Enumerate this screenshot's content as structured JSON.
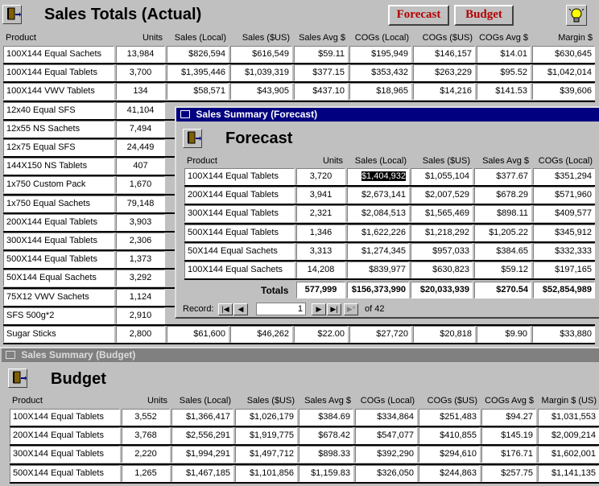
{
  "actual": {
    "title": "Sales Totals (Actual)",
    "buttons": {
      "forecast": "Forecast",
      "budget": "Budget"
    },
    "headers": [
      "Product",
      "Units",
      "Sales (Local)",
      "Sales ($US)",
      "Sales Avg $",
      "COGs (Local)",
      "COGs ($US)",
      "COGs Avg $",
      "Margin $"
    ],
    "rows": [
      [
        "100X144 Equal Sachets",
        "13,984",
        "$826,594",
        "$616,549",
        "$59.11",
        "$195,949",
        "$146,157",
        "$14.01",
        "$630,645"
      ],
      [
        "100X144 Equal Tablets",
        "3,700",
        "$1,395,446",
        "$1,039,319",
        "$377.15",
        "$353,432",
        "$263,229",
        "$95.52",
        "$1,042,014"
      ],
      [
        "100X144 VWV Tablets",
        "134",
        "$58,571",
        "$43,905",
        "$437.10",
        "$18,965",
        "$14,216",
        "$141.53",
        "$39,606"
      ],
      [
        "12x40 Equal SFS",
        "41,104"
      ],
      [
        "12x55 NS Sachets",
        "7,494"
      ],
      [
        "12x75 Equal SFS",
        "24,449"
      ],
      [
        "144X150 NS Tablets",
        "407"
      ],
      [
        "1x750 Custom Pack",
        "1,670"
      ],
      [
        "1x750 Equal Sachets",
        "79,148"
      ],
      [
        "200X144 Equal Tablets",
        "3,903"
      ],
      [
        "300X144 Equal Tablets",
        "2,306"
      ],
      [
        "500X144 Equal Tablets",
        "1,373"
      ],
      [
        "50X144 Equal Sachets",
        "3,292"
      ],
      [
        "75X12 VWV Sachets",
        "1,124"
      ],
      [
        "SFS 500g*2",
        "2,910"
      ],
      [
        "Sugar Sticks",
        "2,800",
        "$61,600",
        "$46,262",
        "$22.00",
        "$27,720",
        "$20,818",
        "$9.90",
        "$33,880"
      ]
    ]
  },
  "forecast": {
    "window_title": "Sales Summary (Forecast)",
    "heading": "Forecast",
    "headers": [
      "Product",
      "Units",
      "Sales (Local)",
      "Sales ($US)",
      "Sales Avg $",
      "COGs (Local)"
    ],
    "rows": [
      [
        "100X144 Equal Tablets",
        "3,720",
        "$1,404,932",
        "$1,055,104",
        "$377.67",
        "$351,294"
      ],
      [
        "200X144 Equal Tablets",
        "3,941",
        "$2,673,141",
        "$2,007,529",
        "$678.29",
        "$571,960"
      ],
      [
        "300X144 Equal Tablets",
        "2,321",
        "$2,084,513",
        "$1,565,469",
        "$898.11",
        "$409,577"
      ],
      [
        "500X144 Equal Tablets",
        "1,346",
        "$1,622,226",
        "$1,218,292",
        "$1,205.22",
        "$345,912"
      ],
      [
        "50X144 Equal Sachets",
        "3,313",
        "$1,274,345",
        "$957,033",
        "$384.65",
        "$332,333"
      ],
      [
        "100X144 Equal Sachets",
        "14,208",
        "$839,977",
        "$630,823",
        "$59.12",
        "$197,165"
      ]
    ],
    "totals_label": "Totals",
    "totals": [
      "577,999",
      "$156,373,990",
      "$20,033,939",
      "$270.54",
      "$52,854,989"
    ],
    "record_label": "Record:",
    "record_value": "1",
    "record_of": "of  42"
  },
  "budget": {
    "window_title": "Sales Summary (Budget)",
    "heading": "Budget",
    "headers": [
      "Product",
      "Units",
      "Sales (Local)",
      "Sales ($US)",
      "Sales Avg $",
      "COGs (Local)",
      "COGs ($US)",
      "COGs Avg $",
      "Margin $ (US)"
    ],
    "rows": [
      [
        "100X144 Equal Tablets",
        "3,552",
        "$1,366,417",
        "$1,026,179",
        "$384.69",
        "$334,864",
        "$251,483",
        "$94.27",
        "$1,031,553"
      ],
      [
        "200X144 Equal Tablets",
        "3,768",
        "$2,556,291",
        "$1,919,775",
        "$678.42",
        "$547,077",
        "$410,855",
        "$145.19",
        "$2,009,214"
      ],
      [
        "300X144 Equal Tablets",
        "2,220",
        "$1,994,291",
        "$1,497,712",
        "$898.33",
        "$392,290",
        "$294,610",
        "$176.71",
        "$1,602,001"
      ],
      [
        "500X144 Equal Tablets",
        "1,265",
        "$1,467,185",
        "$1,101,856",
        "$1,159.83",
        "$326,050",
        "$244,863",
        "$257.75",
        "$1,141,135"
      ]
    ]
  },
  "icons": {
    "exit": "exit-door-icon",
    "idea": "lightbulb-icon",
    "form": "form-window-icon"
  },
  "colors": {
    "active_title": "#000080",
    "inactive_title": "#808080",
    "button_text": "#b40000"
  }
}
